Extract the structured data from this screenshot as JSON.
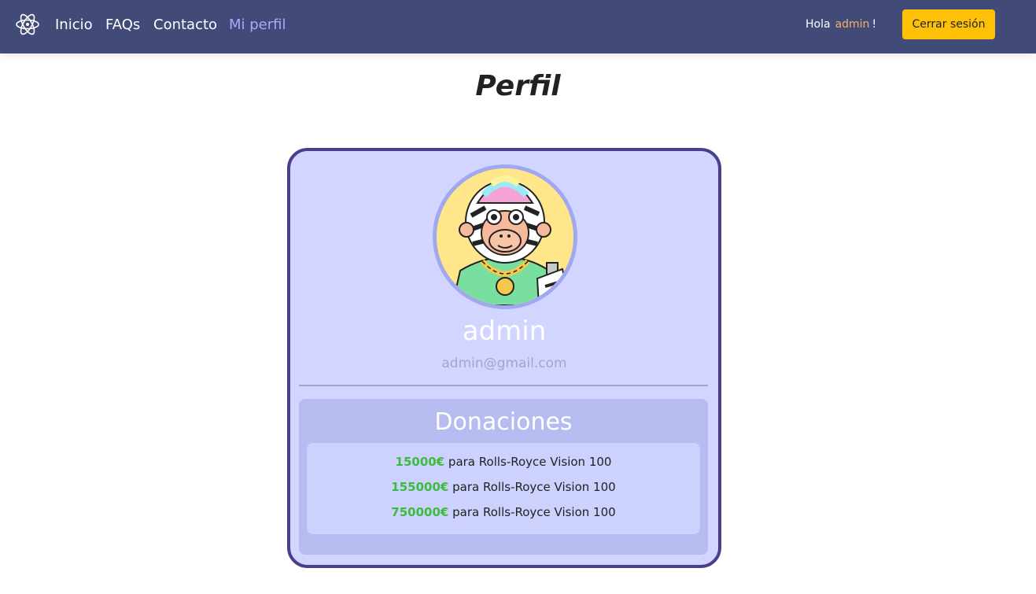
{
  "navbar": {
    "logo_icon": "atom-flower-logo-icon",
    "links": [
      {
        "label": "Inicio",
        "active": false
      },
      {
        "label": "FAQs",
        "active": false
      },
      {
        "label": "Contacto",
        "active": false
      },
      {
        "label": "Mi perfil",
        "active": true
      }
    ],
    "greeting_prefix": "Hola",
    "greeting_user": "admin",
    "greeting_suffix": "!",
    "logout_label": "Cerrar sesión"
  },
  "page": {
    "title": "Perfil"
  },
  "profile": {
    "avatar_icon": "ape-avatar-image",
    "name": "admin",
    "email": "admin@gmail.com"
  },
  "donations": {
    "title": "Donaciones",
    "items": [
      {
        "amount": "15000€",
        "text": "para Rolls-Royce Vision 100"
      },
      {
        "amount": "155000€",
        "text": "para Rolls-Royce Vision 100"
      },
      {
        "amount": "750000€",
        "text": "para Rolls-Royce Vision 100"
      }
    ]
  },
  "colors": {
    "navbar_bg": "#424b77",
    "active_link": "#a5aaff",
    "logout_button": "#ffc107",
    "card_bg": "#d1d5ff",
    "card_border": "#4a3f8a",
    "donation_amount": "#3dbb3d"
  }
}
